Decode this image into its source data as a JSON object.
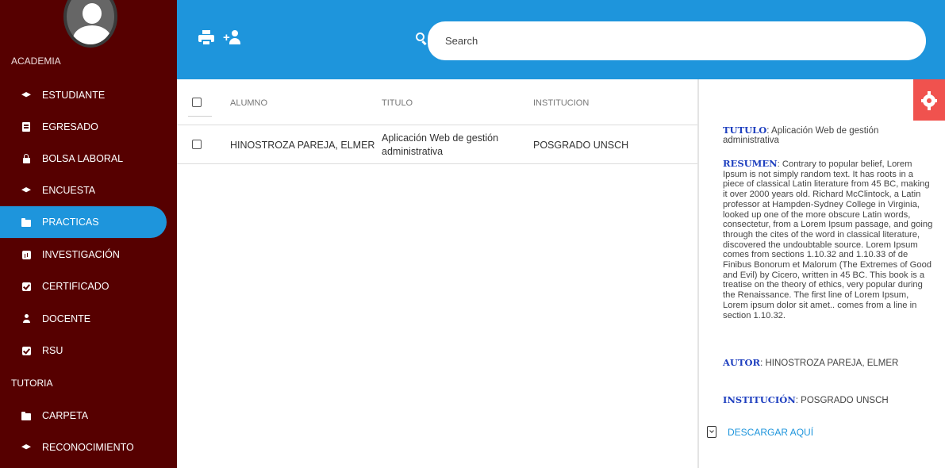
{
  "sidebar": {
    "section1_label": "ACADEMIA",
    "section2_label": "TUTORIA",
    "items": [
      {
        "label": "ESTUDIANTE",
        "icon": "graduation-cap-icon"
      },
      {
        "label": "EGRESADO",
        "icon": "document-icon"
      },
      {
        "label": "BOLSA LABORAL",
        "icon": "lock-icon"
      },
      {
        "label": "ENCUESTA",
        "icon": "graduation-cap-icon"
      },
      {
        "label": "PRACTICAS",
        "icon": "folder-icon",
        "active": true
      },
      {
        "label": "INVESTIGACIÓN",
        "icon": "bar-chart-icon"
      },
      {
        "label": "CERTIFICADO",
        "icon": "checkbox-icon"
      },
      {
        "label": "DOCENTE",
        "icon": "user-icon"
      },
      {
        "label": "RSU",
        "icon": "checkbox-icon"
      }
    ],
    "tutoria_items": [
      {
        "label": "CARPETA",
        "icon": "folder-icon"
      },
      {
        "label": "RECONOCIMIENTO",
        "icon": "graduation-cap-icon"
      }
    ]
  },
  "topbar": {
    "print_icon": "print-icon",
    "add_user_icon": "add-user-icon",
    "search_placeholder": "Search"
  },
  "table": {
    "headers": [
      "ALUMNO",
      "TITULO",
      "INSTITUCION"
    ],
    "rows": [
      {
        "alumno": "HINOSTROZA PAREJA, ELMER",
        "titulo": "Aplicación Web de gestión administrativa",
        "institucion": "POSGRADO UNSCH"
      }
    ]
  },
  "detail": {
    "titulo_label": "TUTULO",
    "titulo_value": ": Aplicación Web de gestión administrativa",
    "resumen_label": "RESUMEN",
    "resumen_value": ": Contrary to popular belief, Lorem Ipsum is not simply random text. It has roots in a piece of classical Latin literature from 45 BC, making it over 2000 years old. Richard McClintock, a Latin professor at Hampden-Sydney College in Virginia, looked up one of the more obscure Latin words, consectetur, from a Lorem Ipsum passage, and going through the cites of the word in classical literature, discovered the undoubtable source. Lorem Ipsum comes from sections 1.10.32 and 1.10.33 of de Finibus Bonorum et Malorum (The Extremes of Good and Evil) by Cicero, written in 45 BC. This book is a treatise on the theory of ethics, very popular during the Renaissance. The first line of Lorem Ipsum, Lorem ipsum dolor sit amet.. comes from a line in section 1.10.32.",
    "autor_label": "AUTOR",
    "autor_value": ": HINOSTROZA PAREJA, ELMER",
    "institucion_label": "INSTITUCIÓN",
    "institucion_value": ": POSGRADO UNSCH",
    "download_label": "DESCARGAR AQUÍ"
  },
  "colors": {
    "sidebar_bg": "#560000",
    "topbar_bg": "#1e95dc",
    "settings_button": "#f0524e",
    "label_blue": "#1e3fbf"
  }
}
